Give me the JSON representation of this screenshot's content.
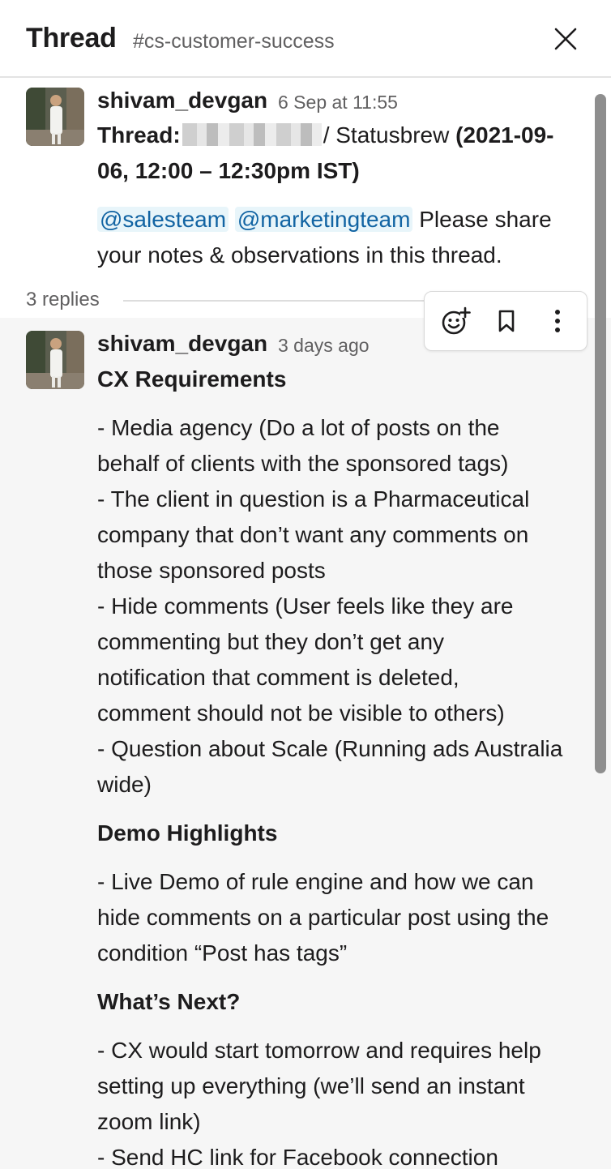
{
  "header": {
    "title": "Thread",
    "channel": "#cs-customer-success"
  },
  "parent": {
    "author": "shivam_devgan",
    "timestamp": "6 Sep at 11:55",
    "line1_prefix": "Thread:",
    "line1_sep": "/ Statusbrew ",
    "line1_date": "(2021-09-",
    "line2": "06, 12:00 – 12:30pm IST)",
    "mention1": "@salesteam",
    "mention2": "@marketingteam",
    "line3_text": " Please share",
    "line4": "your notes & observations in this thread."
  },
  "replies": {
    "count_label": "3 replies"
  },
  "reply": {
    "author": "shivam_devgan",
    "timestamp": "3 days ago",
    "lines": [
      "CX Requirements",
      "- Media agency (Do a lot of posts on the",
      "behalf of clients with the sponsored tags)",
      "- The client in question is a Pharmaceutical",
      "company that don’t want any comments on",
      "those sponsored posts",
      "- Hide comments (User feels like they are",
      "commenting but they don’t get any",
      "notification that comment is deleted,",
      "comment should not be visible to others)",
      "- Question about Scale (Running ads Australia",
      "wide)",
      "Demo Highlights",
      "- Live Demo of rule engine and how we can",
      "hide comments on a particular post using the",
      "condition “Post has tags”",
      "What’s Next?",
      "- CX would start tomorrow and requires help",
      "setting up everything (we’ll send an instant",
      "zoom link)",
      "- Send HC link for Facebook connection"
    ]
  },
  "actions": {
    "icons": [
      "add-reaction-icon",
      "bookmark-icon",
      "more-actions-icon"
    ]
  },
  "colors": {
    "mention_text": "#1264a3",
    "mention_bg": "#e8f5fa",
    "reply_bg": "#f6f6f6",
    "muted_text": "#616061"
  }
}
